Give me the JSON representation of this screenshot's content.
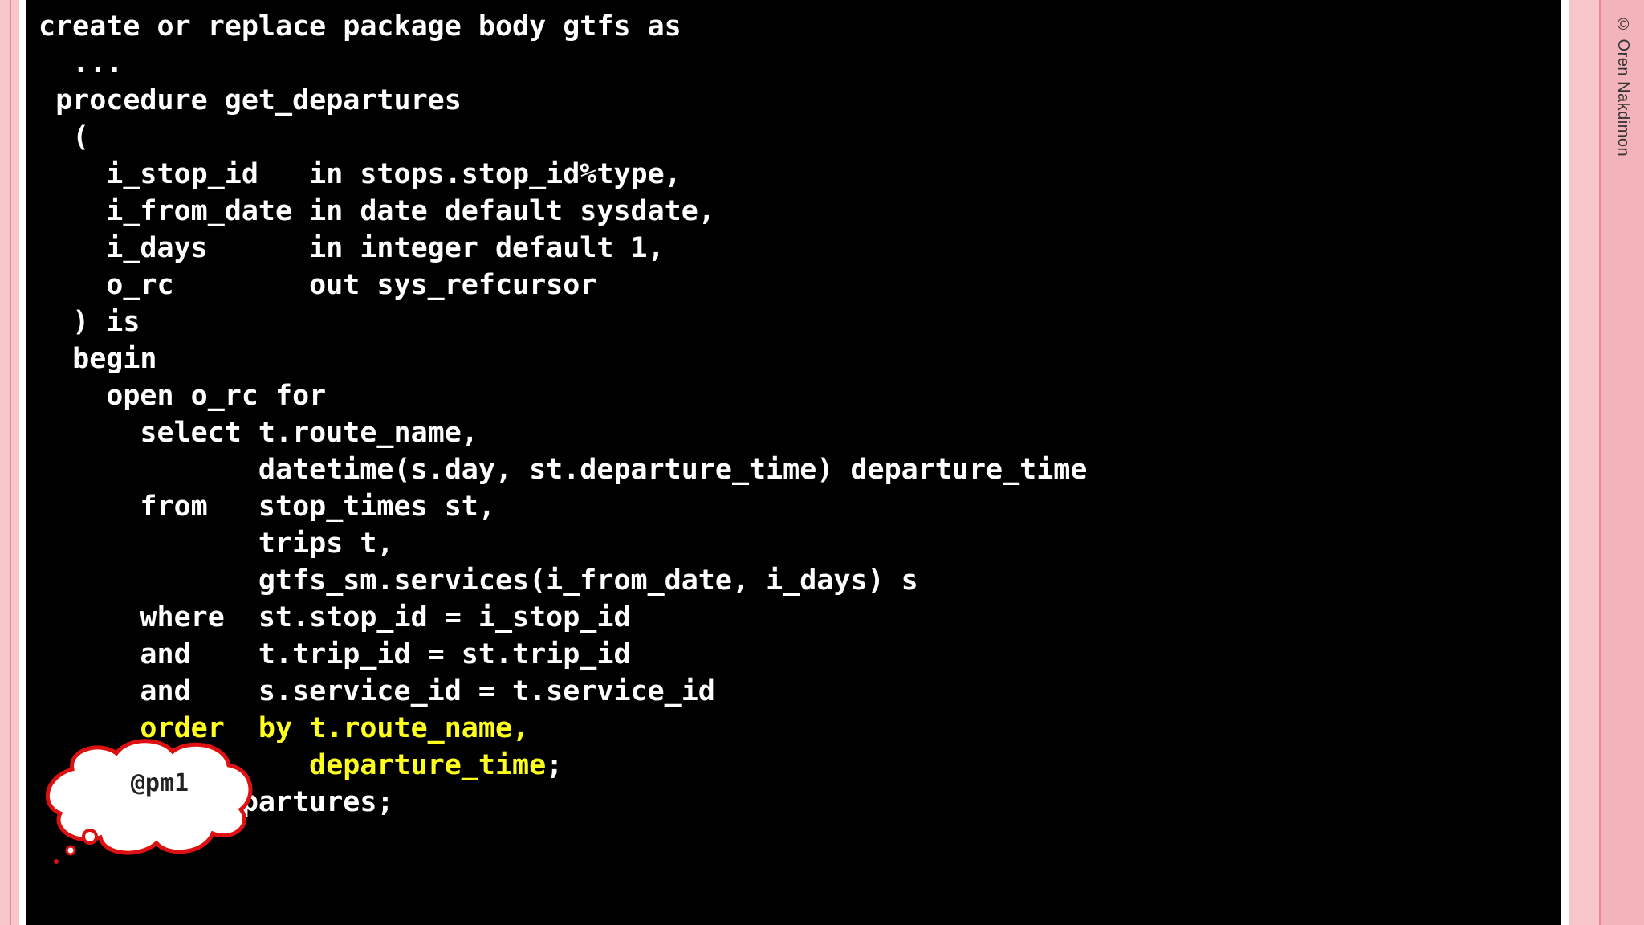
{
  "copyright": "© Oren Nakdimon",
  "code_lines": [
    {
      "text": "create or replace package body gtfs as",
      "highlight": false
    },
    {
      "text": "  ...",
      "highlight": false
    },
    {
      "text": " procedure get_departures",
      "highlight": false
    },
    {
      "text": "  (",
      "highlight": false
    },
    {
      "text": "    i_stop_id   in stops.stop_id%type,",
      "highlight": false
    },
    {
      "text": "    i_from_date in date default sysdate,",
      "highlight": false
    },
    {
      "text": "    i_days      in integer default 1,",
      "highlight": false
    },
    {
      "text": "    o_rc        out sys_refcursor",
      "highlight": false
    },
    {
      "text": "  ) is",
      "highlight": false
    },
    {
      "text": "  begin",
      "highlight": false
    },
    {
      "text": "    open o_rc for",
      "highlight": false
    },
    {
      "text": "      select t.route_name,",
      "highlight": false
    },
    {
      "text": "             datetime(s.day, st.departure_time) departure_time",
      "highlight": false
    },
    {
      "text": "      from   stop_times st,",
      "highlight": false
    },
    {
      "text": "             trips t,",
      "highlight": false
    },
    {
      "text": "             gtfs_sm.services(i_from_date, i_days) s",
      "highlight": false
    },
    {
      "text": "      where  st.stop_id = i_stop_id",
      "highlight": false
    },
    {
      "text": "      and    t.trip_id = st.trip_id",
      "highlight": false
    },
    {
      "text": "      and    s.service_id = t.service_id",
      "highlight": false
    },
    {
      "text": "      order  by t.route_name,",
      "highlight": true
    },
    {
      "text": "                departure_time",
      "highlight": true,
      "suffix": ";"
    },
    {
      "text": "  end get_departures;",
      "highlight": false
    }
  ],
  "thought_bubble": {
    "label": "@pm1",
    "fill_color": "#ffffff",
    "border_color": "#dd1111"
  },
  "colors": {
    "background": "#000000",
    "code_text": "#ffffff",
    "highlight": "#ffff1e",
    "frame_pink": "#f6c6cb"
  }
}
